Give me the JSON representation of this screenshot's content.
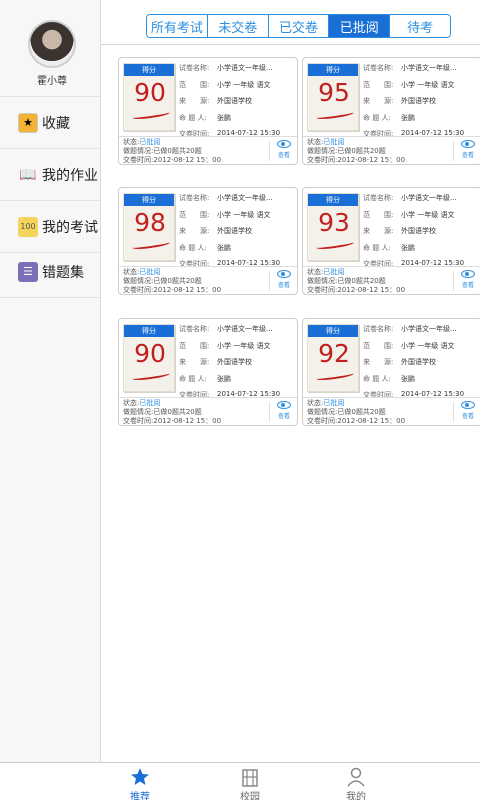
{
  "user": {
    "name": "霍小尊"
  },
  "sidebar": {
    "items": [
      {
        "label": "收藏",
        "icon": "star-folder-icon"
      },
      {
        "label": "我的作业",
        "icon": "book-icon"
      },
      {
        "label": "我的考试",
        "icon": "exam-paper-icon"
      },
      {
        "label": "错题集",
        "icon": "list-book-icon"
      }
    ]
  },
  "tabs": [
    {
      "label": "所有考试",
      "active": false
    },
    {
      "label": "未交卷",
      "active": false
    },
    {
      "label": "已交卷",
      "active": false
    },
    {
      "label": "已批阅",
      "active": true
    },
    {
      "label": "待考",
      "active": false
    }
  ],
  "card_labels": {
    "score_head": "得分",
    "name_k": "试卷名称:",
    "scope_k": "范　　围:",
    "source_k": "来　　源:",
    "author_k": "命 题 人:",
    "submit_k": "交卷时间:",
    "status_k": "状态:",
    "progress_k": "做题情况:",
    "deliver_k": "交卷时间:",
    "view": "查看"
  },
  "exams": [
    {
      "score": "90",
      "name": "小学语文一年级...",
      "scope": "小学 一年级 语文",
      "source": "外国语学校",
      "author": "张鹏",
      "submit_time": "2014-07-12 15:30",
      "status": "已批阅",
      "progress": "已做0题共20题",
      "deliver_time": "2012-08-12 15：00"
    },
    {
      "score": "95",
      "name": "小学语文一年级...",
      "scope": "小学 一年级 语文",
      "source": "外国语学校",
      "author": "张鹏",
      "submit_time": "2014-07-12 15:30",
      "status": "已批阅",
      "progress": "已做0题共20题",
      "deliver_time": "2012-08-12 15：00"
    },
    {
      "score": "98",
      "name": "小学语文一年级...",
      "scope": "小学 一年级 语文",
      "source": "外国语学校",
      "author": "张鹏",
      "submit_time": "2014-07-12 15:30",
      "status": "已批阅",
      "progress": "已做0题共20题",
      "deliver_time": "2012-08-12 15：00"
    },
    {
      "score": "93",
      "name": "小学语文一年级...",
      "scope": "小学 一年级 语文",
      "source": "外国语学校",
      "author": "张鹏",
      "submit_time": "2014-07-12 15:30",
      "status": "已批阅",
      "progress": "已做0题共20题",
      "deliver_time": "2012-08-12 15：00"
    },
    {
      "score": "90",
      "name": "小学语文一年级...",
      "scope": "小学 一年级 语文",
      "source": "外国语学校",
      "author": "张鹏",
      "submit_time": "2014-07-12 15:30",
      "status": "已批阅",
      "progress": "已做0题共20题",
      "deliver_time": "2012-08-12 15：00"
    },
    {
      "score": "92",
      "name": "小学语文一年级...",
      "scope": "小学 一年级 语文",
      "source": "外国语学校",
      "author": "张鹏",
      "submit_time": "2014-07-12 15:30",
      "status": "已批阅",
      "progress": "已做0题共20题",
      "deliver_time": "2012-08-12 15：00"
    }
  ],
  "bottom_nav": [
    {
      "label": "推荐",
      "icon": "pin-icon",
      "active": true
    },
    {
      "label": "校园",
      "icon": "building-icon",
      "active": false
    },
    {
      "label": "我的",
      "icon": "person-icon",
      "active": false
    }
  ],
  "colors": {
    "accent": "#1a6fd6",
    "score_red": "#c21f1f"
  }
}
